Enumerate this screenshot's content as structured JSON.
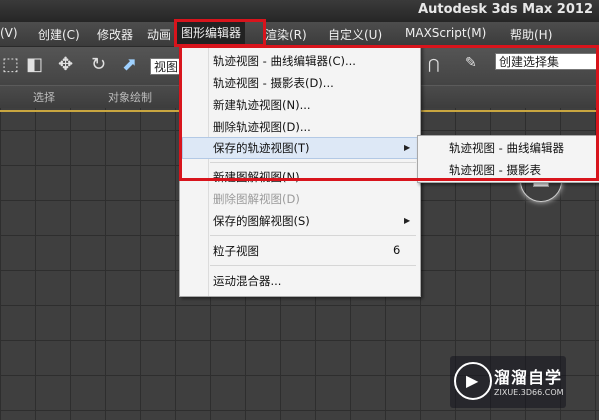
{
  "app_title": "Autodesk 3ds Max  2012",
  "menubar": {
    "items": [
      "(V)",
      "创建(C)",
      "修改器",
      "动画",
      "图形编辑器",
      "渲染(R)",
      "自定义(U)",
      "MAXScript(M)",
      "帮助(H)"
    ]
  },
  "toolbar": {
    "view_combo": "视图",
    "selection_set_placeholder": "创建选择集"
  },
  "ribbon": {
    "labels": [
      "选择",
      "对象绘制"
    ]
  },
  "graph_menu": {
    "items": [
      {
        "label": "轨迹视图 - 曲线编辑器(C)..."
      },
      {
        "label": "轨迹视图 - 摄影表(D)..."
      },
      {
        "label": "新建轨迹视图(N)..."
      },
      {
        "label": "删除轨迹视图(D)..."
      },
      {
        "label": "保存的轨迹视图(T)",
        "submenu": true,
        "highlighted": true
      },
      {
        "label": "新建图解视图(N)"
      },
      {
        "label": "删除图解视图(D)",
        "disabled": true
      },
      {
        "label": "保存的图解视图(S)",
        "submenu": true
      },
      {
        "label": "粒子视图",
        "shortcut": "6"
      },
      {
        "label": "运动混合器..."
      }
    ]
  },
  "submenu": {
    "items": [
      "轨迹视图 - 曲线编辑器",
      "轨迹视图 - 摄影表"
    ]
  },
  "watermark": {
    "name": "溜溜自学",
    "url": "ZIXUE.3D66.COM"
  },
  "colors": {
    "highlight_box": "#d8141c",
    "menu_background": "#f4f4f4",
    "viewport_border": "#c9a640"
  }
}
